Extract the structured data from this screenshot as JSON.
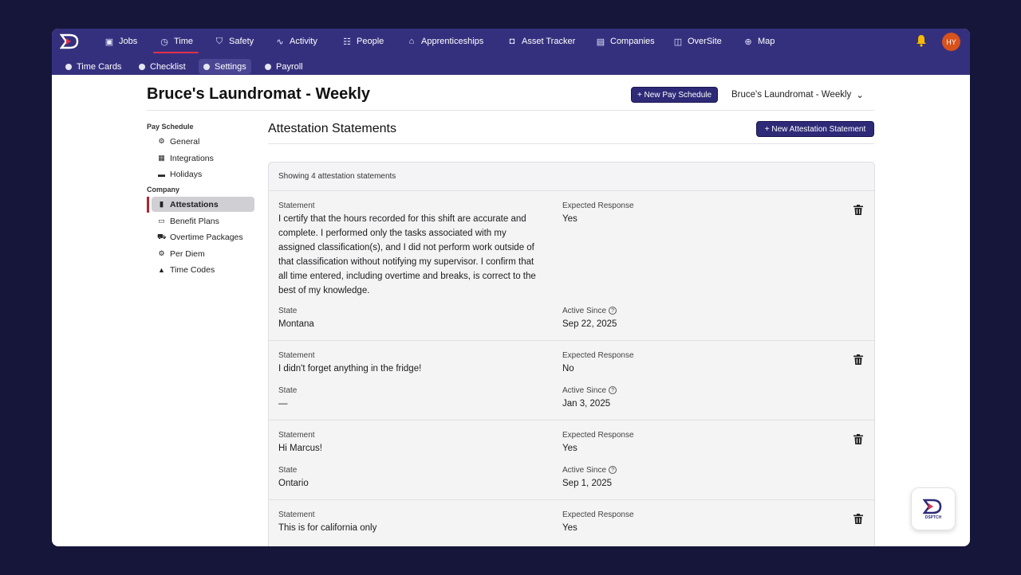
{
  "topnav": {
    "items": [
      {
        "label": "Jobs",
        "icon": "briefcase-icon"
      },
      {
        "label": "Time",
        "icon": "clock-icon"
      },
      {
        "label": "Safety",
        "icon": "shield-icon"
      },
      {
        "label": "Activity",
        "icon": "activity-icon"
      },
      {
        "label": "People",
        "icon": "people-icon"
      },
      {
        "label": "Apprenticeships",
        "icon": "graduation-cap-icon"
      },
      {
        "label": "Asset Tracker",
        "icon": "asset-icon"
      },
      {
        "label": "Companies",
        "icon": "building-icon"
      },
      {
        "label": "OverSite",
        "icon": "map-fold-icon"
      },
      {
        "label": "Map",
        "icon": "globe-icon"
      }
    ],
    "active": "Time",
    "avatar_initials": "HY"
  },
  "subnav": {
    "items": [
      "Time Cards",
      "Checklist",
      "Settings",
      "Payroll"
    ],
    "active": "Settings"
  },
  "page": {
    "title": "Bruce's Laundromat - Weekly",
    "new_pay_schedule_label": "+ New Pay Schedule",
    "schedule_selected": "Bruce's Laundromat - Weekly"
  },
  "sidebar": {
    "pay_schedule_heading": "Pay Schedule",
    "pay_schedule_items": [
      {
        "label": "General",
        "icon": "gear-icon"
      },
      {
        "label": "Integrations",
        "icon": "table-icon"
      },
      {
        "label": "Holidays",
        "icon": "calendar-icon"
      }
    ],
    "company_heading": "Company",
    "company_items": [
      {
        "label": "Attestations",
        "icon": "clipboard-icon"
      },
      {
        "label": "Benefit Plans",
        "icon": "card-icon"
      },
      {
        "label": "Overtime Packages",
        "icon": "truck-icon"
      },
      {
        "label": "Per Diem",
        "icon": "gear-icon"
      },
      {
        "label": "Time Codes",
        "icon": "bell-icon"
      }
    ],
    "active": "Attestations"
  },
  "attestations": {
    "title": "Attestation Statements",
    "new_button_label": "+ New Attestation Statement",
    "showing_text": "Showing 4 attestation statements",
    "labels": {
      "statement": "Statement",
      "expected_response": "Expected Response",
      "state": "State",
      "active_since": "Active Since"
    },
    "rows": [
      {
        "statement": "I certify that the hours recorded for this shift are accurate and complete. I performed only the tasks associated with my assigned classification(s), and I did not perform work outside of that classification without notifying my supervisor. I confirm that all time entered, including overtime and breaks, is correct to the best of my knowledge.",
        "expected_response": "Yes",
        "state": "Montana",
        "active_since": "Sep 22, 2025"
      },
      {
        "statement": "I didn't forget anything in the fridge!",
        "expected_response": "No",
        "state": "—",
        "active_since": "Jan 3, 2025"
      },
      {
        "statement": "Hi Marcus!",
        "expected_response": "Yes",
        "state": "Ontario",
        "active_since": "Sep 1, 2025"
      },
      {
        "statement": "This is for california only",
        "expected_response": "Yes",
        "state": "",
        "active_since": ""
      }
    ]
  },
  "fab": {
    "label": "DSPTCH"
  },
  "colors": {
    "nav_bg": "#35307e",
    "accent": "#2e2a77",
    "active_marker": "#b3242f"
  }
}
